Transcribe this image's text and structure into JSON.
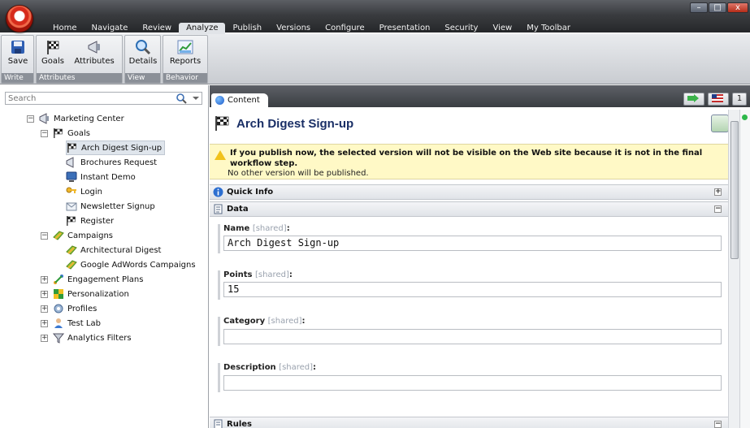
{
  "ribbon_tabs": [
    "Home",
    "Navigate",
    "Review",
    "Analyze",
    "Publish",
    "Versions",
    "Configure",
    "Presentation",
    "Security",
    "View",
    "My Toolbar"
  ],
  "active_tab": "Analyze",
  "window_controls": {
    "minimize": "–",
    "maximize": "□",
    "close": "x"
  },
  "ribbon": {
    "groups": [
      {
        "label": "Write",
        "buttons": [
          "Save"
        ]
      },
      {
        "label": "Attributes",
        "buttons": [
          "Goals",
          "Attributes"
        ]
      },
      {
        "label": "View",
        "buttons": [
          "Details"
        ]
      },
      {
        "label": "Behavior",
        "buttons": [
          "Reports"
        ]
      }
    ]
  },
  "search": {
    "placeholder": "Search"
  },
  "tree": {
    "root": "Marketing Center",
    "goals": "Goals",
    "goal_items": [
      "Arch Digest Sign-up",
      "Brochures Request",
      "Instant Demo",
      "Login",
      "Newsletter Signup",
      "Register"
    ],
    "campaigns": "Campaigns",
    "campaign_items": [
      "Architectural Digest",
      "Google AdWords Campaigns"
    ],
    "others": [
      "Engagement Plans",
      "Personalization",
      "Profiles",
      "Test Lab",
      "Analytics Filters"
    ],
    "selected": "Arch Digest Sign-up"
  },
  "content": {
    "tab_label": "Content",
    "language_tool": "1",
    "title": "Arch Digest Sign-up",
    "warning_bold": "If you publish now, the selected version will not be visible on the Web site because it is not in the final workflow step.",
    "warning_sub": "No other version will be published.",
    "sections": {
      "quick_info": "Quick Info",
      "data": "Data",
      "rules": "Rules"
    },
    "shared_tag": "[shared]",
    "fields": [
      {
        "label": "Name",
        "value": "Arch Digest Sign-up"
      },
      {
        "label": "Points",
        "value": "15"
      },
      {
        "label": "Category",
        "value": ""
      },
      {
        "label": "Description",
        "value": ""
      }
    ]
  },
  "colors": {
    "accent": "#1a2f66",
    "warning_bg": "#fff9c6",
    "selection": "#dfe5ec"
  }
}
